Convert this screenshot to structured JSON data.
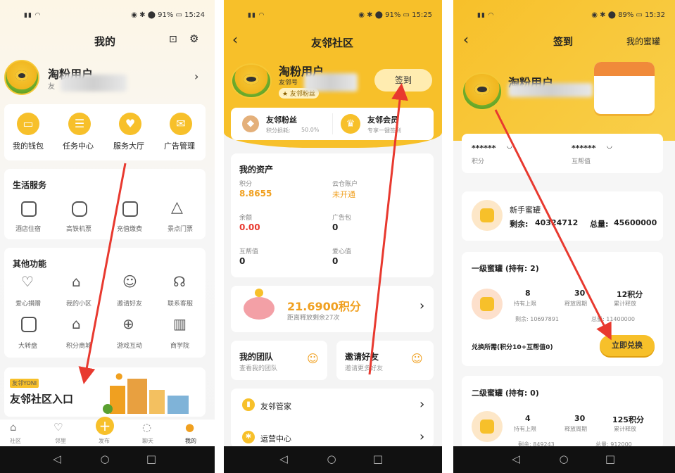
{
  "status": {
    "p1_batt": "91%",
    "p1_time": "15:24",
    "p2_batt": "91%",
    "p2_time": "15:25",
    "p3_batt": "89%",
    "p3_time": "15:32"
  },
  "p1": {
    "title": "我的",
    "username": "淘粉用户",
    "user_sub": "友",
    "top_items": [
      "我的钱包",
      "任务中心",
      "服务大厅",
      "广告管理"
    ],
    "life_title": "生活服务",
    "life_items": [
      "酒店住宿",
      "高铁机票",
      "充值缴费",
      "景点门票"
    ],
    "other_title": "其他功能",
    "other_items_row1": [
      "爱心捐赠",
      "我的小区",
      "邀请好友",
      "联系客服"
    ],
    "other_items_row2": [
      "大转盘",
      "积分商城",
      "游戏互动",
      "商学院"
    ],
    "banner_small": "友邻YONI",
    "banner_title": "友邻社区入口",
    "tabs": [
      "社区",
      "邻里",
      "发布",
      "聊天",
      "我的"
    ]
  },
  "p2": {
    "title": "友邻社区",
    "username": "淘粉用户",
    "user_id": "友邻号",
    "badge": "友邻粉丝",
    "signin_button": "签到",
    "level1_name": "友邻粉丝",
    "level1_sub": "积分损耗:",
    "level1_rate": "50.0%",
    "level2_name": "友邻会员",
    "level2_sub": "专享一键签到",
    "assets_title": "我的资产",
    "points_label": "积分",
    "points_value": "8.8655",
    "cloud_label": "云仓账户",
    "cloud_value": "未开通",
    "balance_label": "余额",
    "balance_value": "0.00",
    "ad_label": "广告包",
    "ad_value": "0",
    "help_label": "互帮值",
    "help_value": "0",
    "love_label": "爱心值",
    "love_value": "0",
    "piggy_points": "21.6900积分",
    "piggy_sub": "距离释放剩余27次",
    "team_title": "我的团队",
    "team_sub": "查看我的团队",
    "invite_title": "邀请好友",
    "invite_sub": "邀请更多好友",
    "menu1": "友邻管家",
    "menu2": "运营中心"
  },
  "p3": {
    "title": "签到",
    "right_link": "我的蜜罐",
    "username": "淘粉用户",
    "points_mask": "******",
    "points_label": "积分",
    "help_mask": "******",
    "help_label": "互帮值",
    "newbie_title": "新手蜜罐",
    "newbie_remain_label": "剩余:",
    "newbie_remain_value": "40324712",
    "newbie_total_label": "总量:",
    "newbie_total_value": "45600000",
    "lvl1_title": "一级蜜罐 (持有: 2)",
    "lvl1_stats": [
      {
        "v": "8",
        "l": "持有上限"
      },
      {
        "v": "30",
        "l": "释放周期"
      },
      {
        "v": "12积分",
        "l": "累计释放"
      }
    ],
    "lvl1_remain": "剩余: 10697891",
    "lvl1_total": "总量: 11400000",
    "lvl1_cost": "兑换所需(积分10+互帮值0)",
    "exchange_button": "立即兑换",
    "lvl2_title": "二级蜜罐 (持有: 0)",
    "lvl2_stats": [
      {
        "v": "4",
        "l": "持有上限"
      },
      {
        "v": "30",
        "l": "释放周期"
      },
      {
        "v": "125积分",
        "l": "累计释放"
      }
    ],
    "lvl2_remain": "剩余: 849243",
    "lvl2_total": "总量: 912000"
  },
  "colors": {
    "accent": "#f7c02a",
    "red": "#e8392f",
    "orange": "#f0a020",
    "dark": "#111111"
  }
}
